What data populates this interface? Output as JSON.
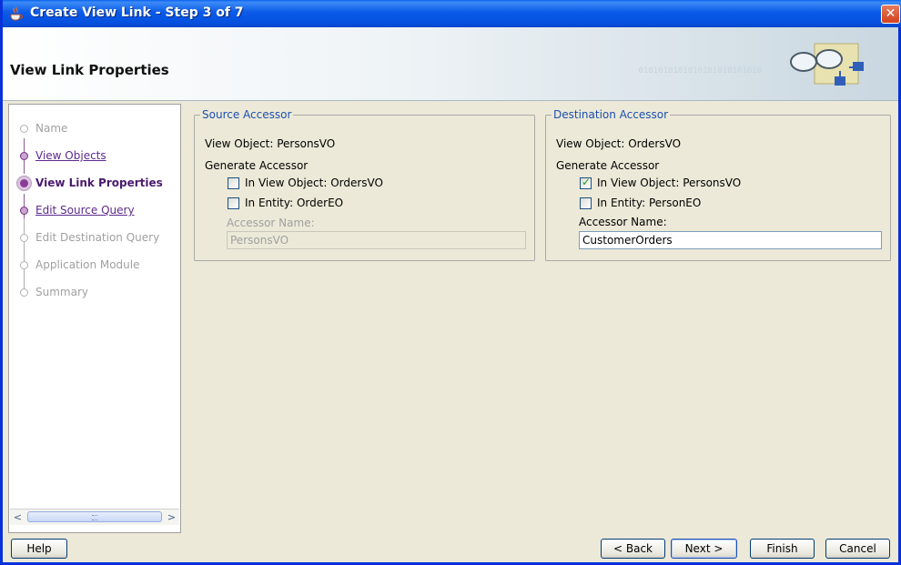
{
  "window": {
    "title": "Create View Link - Step 3 of 7"
  },
  "header": {
    "title": "View Link Properties",
    "binary": "0101010101010101010101010"
  },
  "steps": [
    {
      "label": "Name",
      "state": "pending"
    },
    {
      "label": "View Objects",
      "state": "done"
    },
    {
      "label": "View Link Properties",
      "state": "current"
    },
    {
      "label": "Edit Source Query",
      "state": "done"
    },
    {
      "label": "Edit Destination Query",
      "state": "pending"
    },
    {
      "label": "Application Module",
      "state": "pending"
    },
    {
      "label": "Summary",
      "state": "pending"
    }
  ],
  "source": {
    "legend": "Source Accessor",
    "view_object": "View Object: PersonsVO",
    "generate_label": "Generate Accessor",
    "in_view_object_label": "In View Object: OrdersVO",
    "in_view_object_checked": false,
    "in_entity_label": "In Entity: OrderEO",
    "in_entity_checked": false,
    "accessor_name_label": "Accessor Name:",
    "accessor_name_value": "PersonsVO"
  },
  "destination": {
    "legend": "Destination Accessor",
    "view_object": "View Object: OrdersVO",
    "generate_label": "Generate Accessor",
    "in_view_object_label": "In View Object: PersonsVO",
    "in_view_object_checked": true,
    "in_entity_label": "In Entity: PersonEO",
    "in_entity_checked": false,
    "accessor_name_label": "Accessor Name:",
    "accessor_name_value": "CustomerOrders"
  },
  "buttons": {
    "help": "Help",
    "back": "< Back",
    "next": "Next >",
    "finish": "Finish",
    "cancel": "Cancel"
  }
}
